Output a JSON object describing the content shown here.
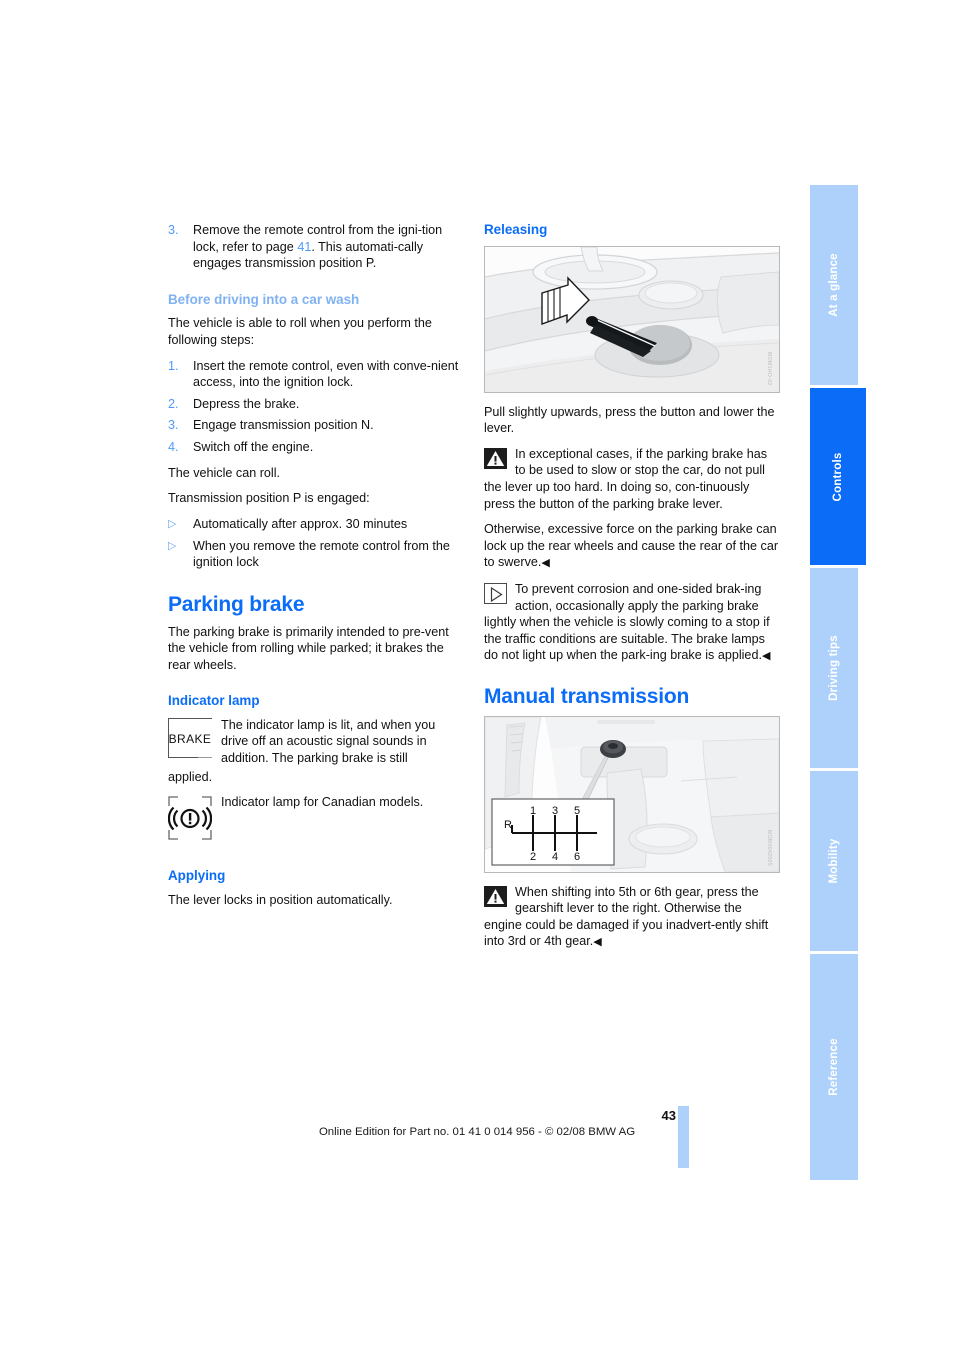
{
  "sidebar": {
    "tabs": [
      {
        "label": "At a glance",
        "active": false
      },
      {
        "label": "Controls",
        "active": true
      },
      {
        "label": "Driving tips",
        "active": false
      },
      {
        "label": "Mobility",
        "active": false
      },
      {
        "label": "Reference",
        "active": false
      }
    ]
  },
  "left_column": {
    "step3": {
      "num": "3.",
      "text_before": "Remove the remote control from the igni-tion lock, refer to page ",
      "page_ref": "41",
      "text_after": ". This automati-cally engages transmission position P."
    },
    "carwash": {
      "heading": "Before driving into a car wash",
      "intro": "The vehicle is able to roll when you perform the following steps:",
      "steps": [
        {
          "num": "1.",
          "text": "Insert the remote control, even with conve-nient access, into the ignition lock."
        },
        {
          "num": "2.",
          "text": "Depress the brake."
        },
        {
          "num": "3.",
          "text": "Engage transmission position N."
        },
        {
          "num": "4.",
          "text": "Switch off the engine."
        }
      ],
      "after_steps": "The vehicle can roll.",
      "p_engaged_intro": "Transmission position P is engaged:",
      "bullets": [
        "Automatically after approx. 30 minutes",
        "When you remove the remote control from the ignition lock"
      ]
    },
    "parking_brake": {
      "heading": "Parking brake",
      "intro": "The parking brake is primarily intended to pre-vent the vehicle from rolling while parked; it brakes the rear wheels."
    },
    "indicator_lamp": {
      "heading": "Indicator lamp",
      "lamp_brake_label": "BRAKE",
      "text_1": "The indicator lamp is lit, and when you drive off an acoustic signal sounds in addition. The parking brake is still",
      "text_1_overflow": "applied.",
      "text_2": "Indicator lamp for Canadian models."
    },
    "applying": {
      "heading": "Applying",
      "text": "The lever locks in position automatically."
    }
  },
  "right_column": {
    "releasing": {
      "heading": "Releasing",
      "figure_code": "MOM1HO-02",
      "caption": "Pull slightly upwards, press the button and lower the lever.",
      "warning": "In exceptional cases, if the parking brake has to be used to slow or stop the car, do not pull the lever up too hard. In doing so, con-tinuously press the button of the parking brake lever.",
      "warning_2": "Otherwise, excessive force on the parking brake can lock up the rear wheels and cause the rear of the car to swerve.",
      "warning_end": "◀",
      "note": "To prevent corrosion and one-sided brak-ing action, occasionally apply the parking brake lightly when the vehicle is slowly coming to a stop if the traffic conditions are suitable. The brake lamps do not light up when the park-ing brake is applied.",
      "note_end": "◀"
    },
    "manual_transmission": {
      "heading": "Manual transmission",
      "figure_code": "MOM0042005",
      "gear_pattern": {
        "reverse": "R",
        "top_row": [
          "1",
          "3",
          "5"
        ],
        "bottom_row": [
          "2",
          "4",
          "6"
        ]
      },
      "warning": "When shifting into 5th or 6th gear, press the gearshift lever to the right. Otherwise the engine could be damaged if you inadvert-ently shift into 3rd or 4th gear.",
      "warning_end": "◀"
    }
  },
  "footer": {
    "text": "Online Edition for Part no. 01 41 0 014 956 - © 02/08 BMW AG",
    "page_number": "43"
  },
  "colors": {
    "heading_blue": "#0a6cf7",
    "pale_blue": "#7fb2f2",
    "tab_blue": "#aed1fb",
    "tab_active": "#0a6cf7"
  }
}
